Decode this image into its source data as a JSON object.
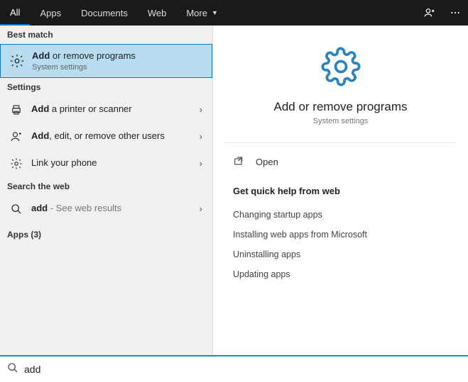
{
  "header": {
    "tabs": {
      "all": "All",
      "apps": "Apps",
      "documents": "Documents",
      "web": "Web",
      "more": "More"
    }
  },
  "left": {
    "best_match_label": "Best match",
    "best_match": {
      "title_bold": "Add",
      "title_rest": " or remove programs",
      "subtitle": "System settings"
    },
    "settings_label": "Settings",
    "settings": [
      {
        "bold": "Add",
        "rest": " a printer or scanner"
      },
      {
        "bold": "Add",
        "rest": ", edit, or remove other users"
      },
      {
        "bold": "",
        "rest": "Link your phone"
      }
    ],
    "search_web_label": "Search the web",
    "web_result": {
      "bold": "add",
      "rest": " - See web results"
    },
    "apps_label": "Apps (3)"
  },
  "preview": {
    "title": "Add or remove programs",
    "subtitle": "System settings",
    "open_label": "Open",
    "help_label": "Get quick help from web",
    "help_links": [
      "Changing startup apps",
      "Installing web apps from Microsoft",
      "Uninstalling apps",
      "Updating apps"
    ]
  },
  "search": {
    "value": "add"
  }
}
